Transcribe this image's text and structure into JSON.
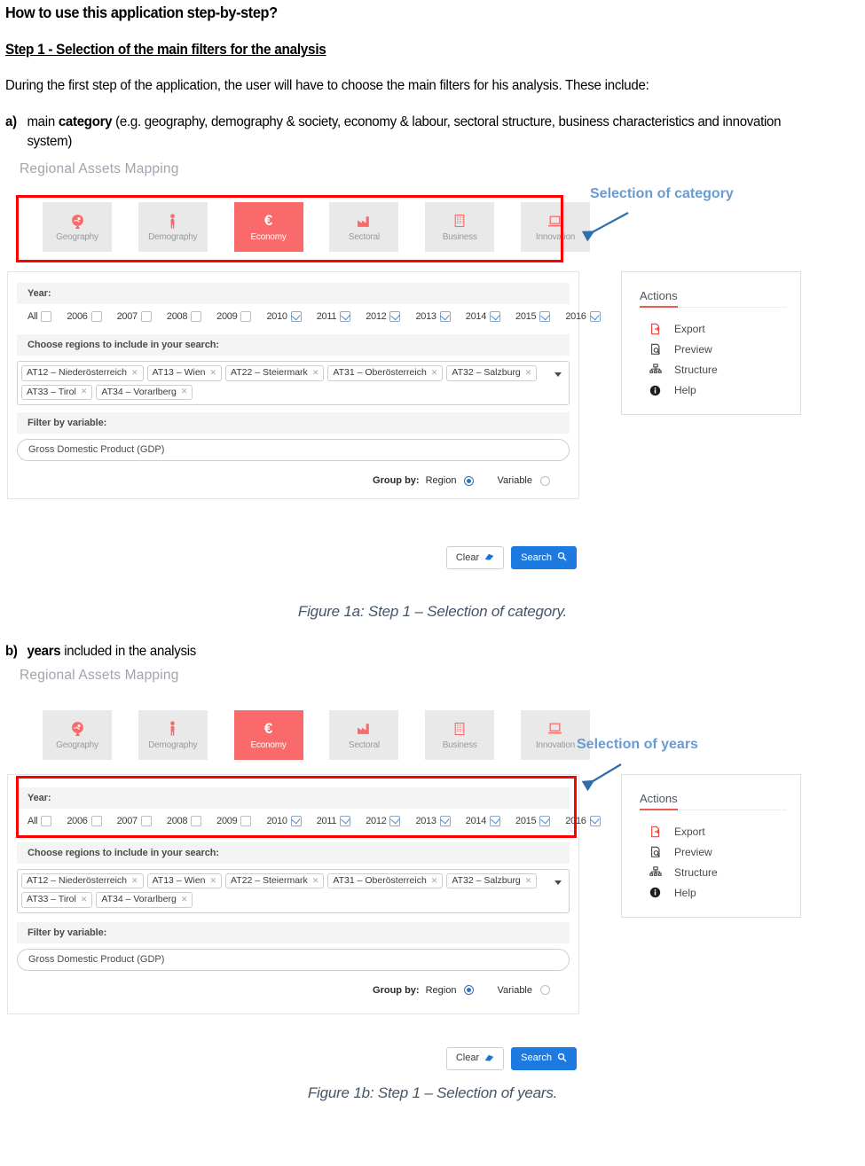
{
  "document": {
    "heading": "How to use this application step-by-step?",
    "step_heading": "Step 1 -  Selection of the main filters for the analysis",
    "intro": "During the first step of the application, the user will have to choose the main filters for his analysis. These include:",
    "item_a": {
      "marker": "a)",
      "text_before": "main ",
      "bold": "category",
      "text_after": " (e.g. geography, demography & society, economy & labour, sectoral structure, business characteristics and innovation system)"
    },
    "item_b": {
      "marker": "b)",
      "bold": "years",
      "text_after": " included in the analysis"
    },
    "caption_a": "Figure 1a:  Step 1 – Selection of category.",
    "caption_b": "Figure 1b:  Step 1 – Selection of years."
  },
  "app": {
    "title": "Regional Assets Mapping",
    "categories": [
      {
        "label": "Geography",
        "icon": "globe-icon",
        "active": false
      },
      {
        "label": "Demography",
        "icon": "person-icon",
        "active": false
      },
      {
        "label": "Economy",
        "icon": "euro-icon",
        "active": true
      },
      {
        "label": "Sectoral",
        "icon": "factory-icon",
        "active": false
      },
      {
        "label": "Business",
        "icon": "building-icon",
        "active": false
      },
      {
        "label": "Innovation",
        "icon": "laptop-icon",
        "active": false
      }
    ],
    "year_section": {
      "header": "Year:",
      "all_label": "All",
      "all_checked": false,
      "years": [
        {
          "label": "2006",
          "checked": false
        },
        {
          "label": "2007",
          "checked": false
        },
        {
          "label": "2008",
          "checked": false
        },
        {
          "label": "2009",
          "checked": false
        },
        {
          "label": "2010",
          "checked": true
        },
        {
          "label": "2011",
          "checked": true
        },
        {
          "label": "2012",
          "checked": true
        },
        {
          "label": "2013",
          "checked": true
        },
        {
          "label": "2014",
          "checked": true
        },
        {
          "label": "2015",
          "checked": true
        },
        {
          "label": "2016",
          "checked": true
        }
      ]
    },
    "region_section": {
      "header": "Choose regions to include in your search:",
      "tags": [
        "AT12 – Niederösterreich",
        "AT13 – Wien",
        "AT22 – Steiermark",
        "AT31 – Oberösterreich",
        "AT32 – Salzburg",
        "AT33 – Tirol",
        "AT34 – Vorarlberg"
      ],
      "remove_glyph": "✕"
    },
    "variable_section": {
      "header": "Filter by variable:",
      "value": "Gross Domestic Product (GDP)"
    },
    "group_by": {
      "label": "Group by:",
      "options": [
        {
          "label": "Region",
          "selected": true
        },
        {
          "label": "Variable",
          "selected": false
        }
      ]
    },
    "buttons": {
      "clear": "Clear",
      "search": "Search"
    },
    "actions_panel": {
      "title": "Actions",
      "items": [
        {
          "label": "Export",
          "icon": "export-file-icon"
        },
        {
          "label": "Preview",
          "icon": "preview-doc-icon"
        },
        {
          "label": "Structure",
          "icon": "structure-tree-icon"
        },
        {
          "label": "Help",
          "icon": "info-icon"
        }
      ]
    }
  },
  "annotations": {
    "category": "Selection of category",
    "years": "Selection of years"
  },
  "colors": {
    "accent_red": "#fa6a6a",
    "highlight_box": "#ff0000",
    "annotation_blue": "#6a9bd1",
    "button_blue": "#1d7ae0",
    "actions_underline": "#ec5b4f",
    "caption": "#44546a"
  }
}
